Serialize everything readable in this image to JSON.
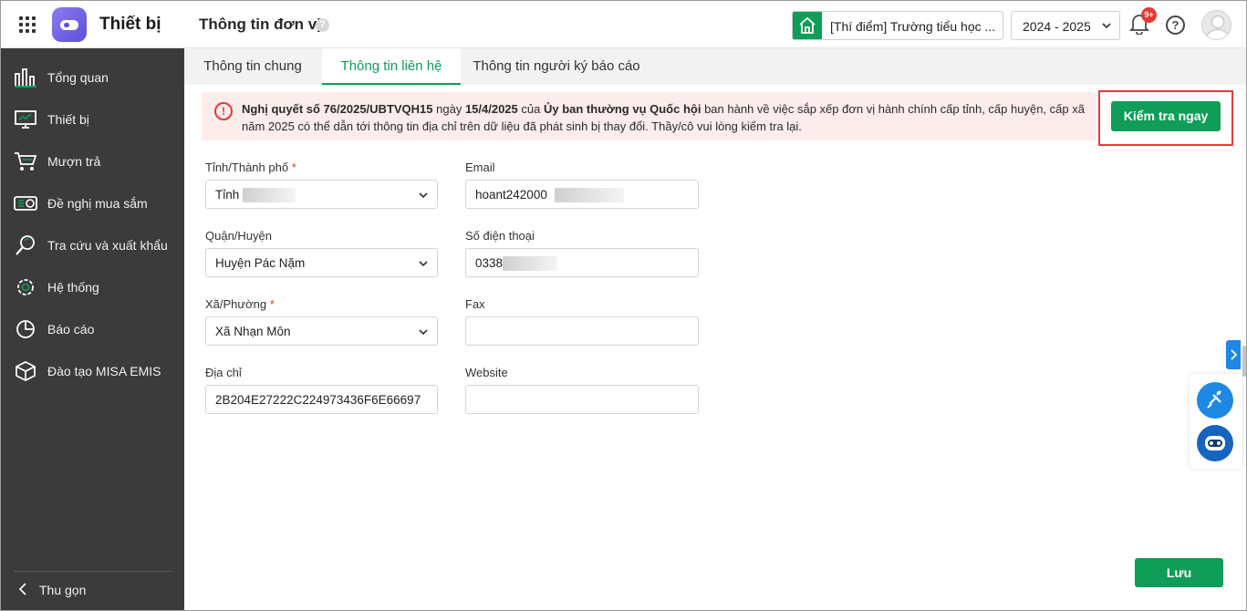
{
  "app": {
    "title": "Thiết bị"
  },
  "header": {
    "page_title": "Thông tin đơn vị",
    "help_mark": "?",
    "school": "[Thí điểm] Trường tiểu học ...",
    "year": "2024 - 2025",
    "notification_count": "9+",
    "help_icon": "?"
  },
  "sidebar": {
    "items": [
      {
        "label": "Tổng quan",
        "icon": "bar-chart-icon"
      },
      {
        "label": "Thiết bị",
        "icon": "monitor-icon"
      },
      {
        "label": "Mượn trả",
        "icon": "cart-icon"
      },
      {
        "label": "Đề nghị mua sắm",
        "icon": "purchase-request-icon"
      },
      {
        "label": "Tra cứu và xuất khẩu",
        "icon": "search-icon"
      },
      {
        "label": "Hệ thống",
        "icon": "gear-icon"
      },
      {
        "label": "Báo cáo",
        "icon": "pie-chart-icon"
      },
      {
        "label": "Đào tạo MISA EMIS",
        "icon": "cube-icon"
      }
    ],
    "collapse_label": "Thu gọn"
  },
  "tabs": [
    {
      "label": "Thông tin chung",
      "active": false
    },
    {
      "label": "Thông tin liên hệ",
      "active": true
    },
    {
      "label": "Thông tin người ký báo cáo",
      "active": false
    }
  ],
  "alert": {
    "part1": "Nghị quyết số 76/2025/UBTVQH15",
    "part2": " ngày ",
    "part3": "15/4/2025",
    "part4": " của ",
    "part5": "Ủy ban thường vụ Quốc hội",
    "part6": " ban hành về việc sắp xếp đơn vị hành chính cấp tỉnh, cấp huyện, cấp xã năm 2025 có thể dẫn tới thông tin địa chỉ trên dữ liệu đã phát sinh bị thay đổi. Thầy/cô vui lòng kiểm tra lại.",
    "button": "Kiểm tra ngay"
  },
  "form": {
    "province": {
      "label": "Tỉnh/Thành phố",
      "required": "*",
      "value": "Tỉnh"
    },
    "district": {
      "label": "Quận/Huyện",
      "value": "Huyện Pác Nặm"
    },
    "ward": {
      "label": "Xã/Phường",
      "required": "*",
      "value": "Xã Nhạn Môn"
    },
    "address": {
      "label": "Địa chỉ",
      "value": "2B204E27222C224973436F6E66697"
    },
    "email": {
      "label": "Email",
      "value": "hoant242000"
    },
    "phone": {
      "label": "Số điện thoại",
      "value": "0338"
    },
    "fax": {
      "label": "Fax",
      "value": ""
    },
    "website": {
      "label": "Website",
      "value": ""
    }
  },
  "save_button": "Lưu",
  "colors": {
    "primary": "#0f9d58",
    "sidebar": "#3b3b3b",
    "alert_bg": "#fdecec",
    "danger": "#e53935",
    "accent_blue": "#1e88e5"
  }
}
